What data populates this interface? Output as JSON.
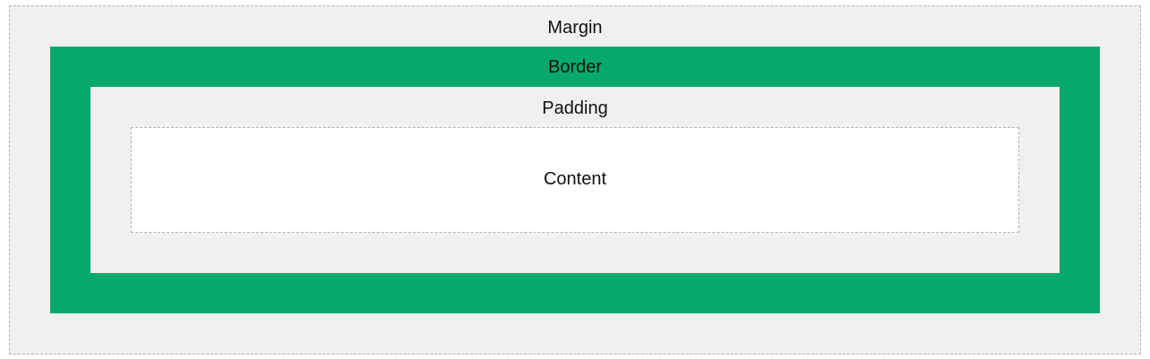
{
  "box_model": {
    "margin_label": "Margin",
    "border_label": "Border",
    "padding_label": "Padding",
    "content_label": "Content"
  },
  "colors": {
    "margin_fill": "#f0f0f0",
    "border_fill": "#06a96c",
    "padding_fill": "#f0f0f0",
    "content_fill": "#ffffff",
    "dashed_outline": "#b4b4b4"
  }
}
